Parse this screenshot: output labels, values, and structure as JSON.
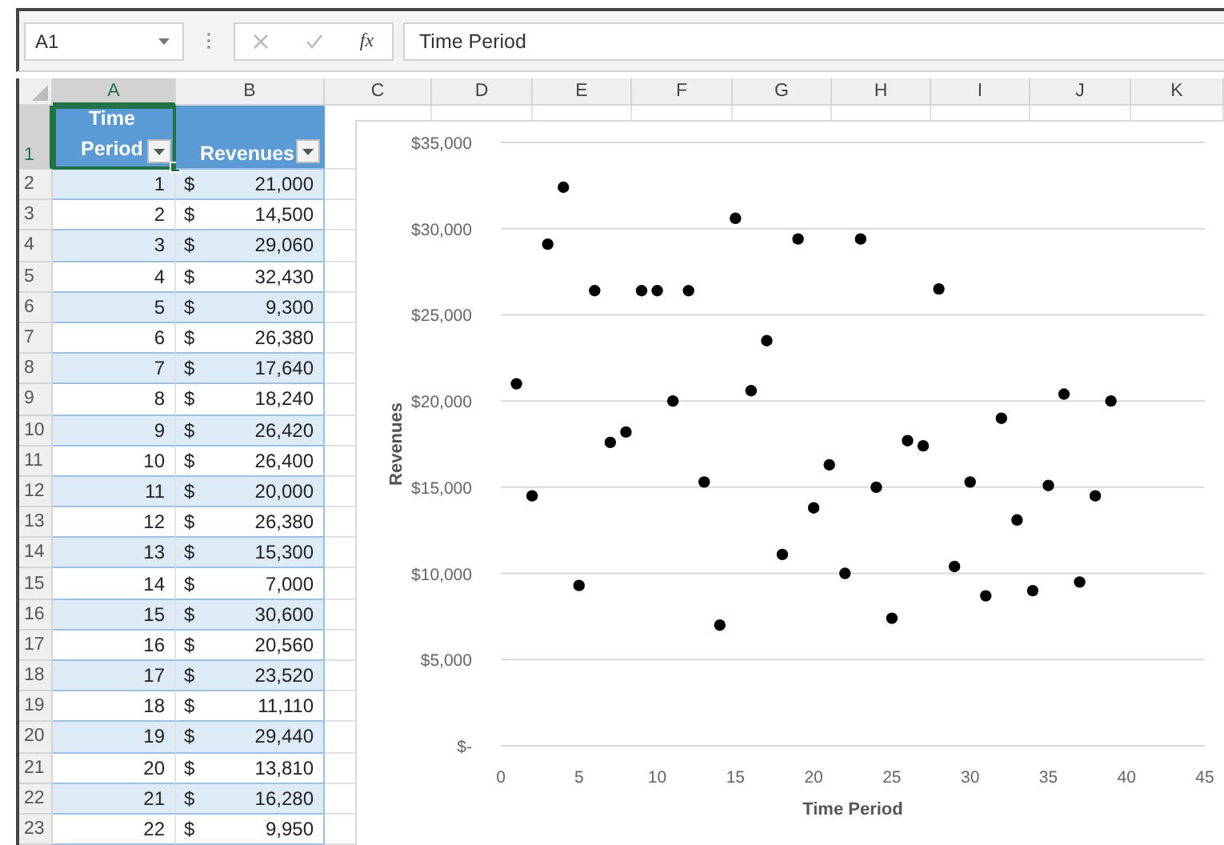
{
  "formula_bar": {
    "name_box": "A1",
    "fx": "fx",
    "formula": "Time Period"
  },
  "columns": [
    {
      "label": "A",
      "selected": true
    },
    {
      "label": "B",
      "selected": false
    },
    {
      "label": "C",
      "selected": false
    },
    {
      "label": "D",
      "selected": false
    },
    {
      "label": "E",
      "selected": false
    },
    {
      "label": "F",
      "selected": false
    },
    {
      "label": "G",
      "selected": false
    },
    {
      "label": "H",
      "selected": false
    },
    {
      "label": "I",
      "selected": false
    },
    {
      "label": "J",
      "selected": false
    },
    {
      "label": "K",
      "selected": false
    }
  ],
  "table": {
    "header_row": {
      "row": "1",
      "selected": true,
      "cells": [
        {
          "label": "Time Period",
          "filter": true,
          "active": true
        },
        {
          "label": "Revenues",
          "filter": true,
          "active": false
        }
      ]
    },
    "rows": [
      {
        "row": "2",
        "selected": false,
        "period": "1",
        "currency": "$",
        "revenue": "21,000"
      },
      {
        "row": "3",
        "selected": false,
        "period": "2",
        "currency": "$",
        "revenue": "14,500"
      },
      {
        "row": "4",
        "selected": false,
        "period": "3",
        "currency": "$",
        "revenue": "29,060"
      },
      {
        "row": "5",
        "selected": false,
        "period": "4",
        "currency": "$",
        "revenue": "32,430"
      },
      {
        "row": "6",
        "selected": false,
        "period": "5",
        "currency": "$",
        "revenue": "9,300"
      },
      {
        "row": "7",
        "selected": false,
        "period": "6",
        "currency": "$",
        "revenue": "26,380"
      },
      {
        "row": "8",
        "selected": false,
        "period": "7",
        "currency": "$",
        "revenue": "17,640"
      },
      {
        "row": "9",
        "selected": false,
        "period": "8",
        "currency": "$",
        "revenue": "18,240"
      },
      {
        "row": "10",
        "selected": false,
        "period": "9",
        "currency": "$",
        "revenue": "26,420"
      },
      {
        "row": "11",
        "selected": false,
        "period": "10",
        "currency": "$",
        "revenue": "26,400"
      },
      {
        "row": "12",
        "selected": false,
        "period": "11",
        "currency": "$",
        "revenue": "20,000"
      },
      {
        "row": "13",
        "selected": false,
        "period": "12",
        "currency": "$",
        "revenue": "26,380"
      },
      {
        "row": "14",
        "selected": false,
        "period": "13",
        "currency": "$",
        "revenue": "15,300"
      },
      {
        "row": "15",
        "selected": false,
        "period": "14",
        "currency": "$",
        "revenue": "7,000"
      },
      {
        "row": "16",
        "selected": false,
        "period": "15",
        "currency": "$",
        "revenue": "30,600"
      },
      {
        "row": "17",
        "selected": false,
        "period": "16",
        "currency": "$",
        "revenue": "20,560"
      },
      {
        "row": "18",
        "selected": false,
        "period": "17",
        "currency": "$",
        "revenue": "23,520"
      },
      {
        "row": "19",
        "selected": false,
        "period": "18",
        "currency": "$",
        "revenue": "11,110"
      },
      {
        "row": "20",
        "selected": false,
        "period": "19",
        "currency": "$",
        "revenue": "29,440"
      },
      {
        "row": "21",
        "selected": false,
        "period": "20",
        "currency": "$",
        "revenue": "13,810"
      },
      {
        "row": "22",
        "selected": false,
        "period": "21",
        "currency": "$",
        "revenue": "16,280"
      },
      {
        "row": "23",
        "selected": false,
        "period": "22",
        "currency": "$",
        "revenue": "9,950"
      }
    ]
  },
  "chart": {
    "chart_data": {
      "type": "scatter",
      "xlabel": "Time Period",
      "ylabel": "Revenues",
      "x": [
        1,
        2,
        3,
        4,
        5,
        6,
        7,
        8,
        9,
        10,
        11,
        12,
        13,
        14,
        15,
        16,
        17,
        18,
        19,
        20,
        21,
        22,
        23,
        24,
        25,
        26,
        27,
        28,
        29,
        30,
        31,
        32,
        33,
        34,
        35,
        36,
        37,
        38,
        39
      ],
      "series": [
        {
          "color": "#000000",
          "values": [
            21000,
            14500,
            29100,
            32400,
            9300,
            26400,
            17600,
            18200,
            26400,
            26400,
            20000,
            26400,
            15300,
            7000,
            30600,
            20600,
            23500,
            11100,
            29400,
            13800,
            16300,
            10000,
            29400,
            15000,
            7400,
            17700,
            17400,
            26500,
            10400,
            15300,
            8700,
            19000,
            13100,
            9000,
            15100,
            20400,
            9500,
            14500,
            20000
          ]
        }
      ],
      "grid": true,
      "xlim": [
        0,
        45
      ],
      "ylim": [
        0,
        35000
      ],
      "xticks": [
        0,
        5,
        10,
        15,
        20,
        25,
        30,
        35,
        40,
        45
      ],
      "yticks": [
        {
          "value": 0,
          "label": "$-"
        },
        {
          "value": 5000,
          "label": "$5,000"
        },
        {
          "value": 10000,
          "label": "$10,000"
        },
        {
          "value": 15000,
          "label": "$15,000"
        },
        {
          "value": 20000,
          "label": "$20,000"
        },
        {
          "value": 25000,
          "label": "$25,000"
        },
        {
          "value": 30000,
          "label": "$30,000"
        },
        {
          "value": 35000,
          "label": "$35,000"
        }
      ]
    }
  }
}
